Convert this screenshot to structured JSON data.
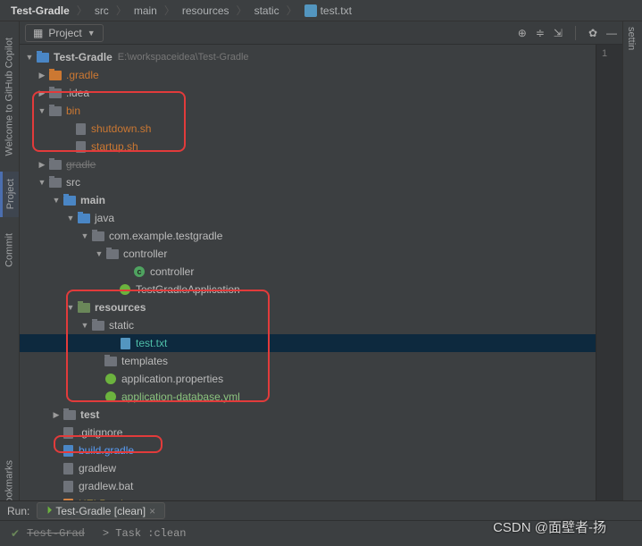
{
  "breadcrumb": {
    "root": "Test-Gradle",
    "seg1": "src",
    "seg2": "main",
    "seg3": "resources",
    "seg4": "static",
    "file": "test.txt"
  },
  "project_dropdown": "Project",
  "right_rail": "settin",
  "rail": {
    "copilot": "Welcome to GitHub Copilot",
    "project": "Project",
    "commit": "Commit",
    "bookmarks": "Bookmarks"
  },
  "tree": {
    "root": "Test-Gradle",
    "root_path": "E:\\workspaceidea\\Test-Gradle",
    "gradle_dir": ".gradle",
    "idea_dir": ".idea",
    "bin": "bin",
    "shutdown": "shutdown.sh",
    "startup": "startup.sh",
    "gradle2": "gradle",
    "src": "src",
    "main": "main",
    "java": "java",
    "pkg": "com.example.testgradle",
    "controller_pkg": "controller",
    "controller_cls": "controller",
    "app_cls": "TestGradleApplication",
    "resources": "resources",
    "static": "static",
    "testtxt": "test.txt",
    "templates": "templates",
    "app_props": "application.properties",
    "app_db_yml": "application-database.yml",
    "test_dir": "test",
    "gitignore": ".gitignore",
    "build_gradle": "build.gradle",
    "gradlew": "gradlew",
    "gradlew_bat": "gradlew.bat",
    "help_md": "HELP.md"
  },
  "run": {
    "label": "Run:",
    "tab": "Test-Gradle [clean]",
    "task_line": "> Task :clean"
  },
  "gutter": {
    "line1": "1"
  },
  "watermark": "CSDN @面壁者-扬"
}
